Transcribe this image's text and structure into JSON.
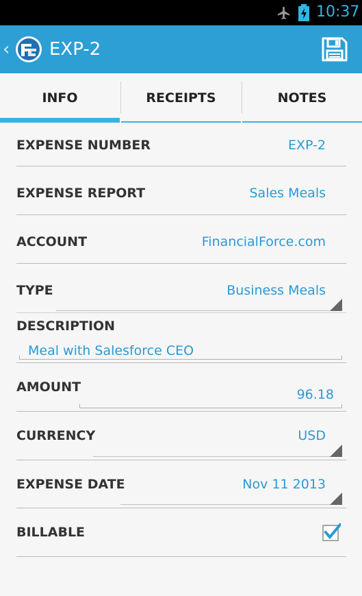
{
  "status_bar": {
    "time": "10:37",
    "accent_color": "#33b5e5"
  },
  "action_bar": {
    "title": "EXP-2",
    "background_color": "#2d9fd5",
    "icons": [
      "back-icon",
      "financialforce-logo",
      "save-icon"
    ]
  },
  "tabs": [
    {
      "label": "INFO",
      "selected": true
    },
    {
      "label": "RECEIPTS",
      "selected": false
    },
    {
      "label": "NOTES",
      "selected": false
    }
  ],
  "fields": {
    "expense_number": {
      "label": "EXPENSE NUMBER",
      "value": "EXP-2"
    },
    "expense_report": {
      "label": "EXPENSE REPORT",
      "value": "Sales Meals"
    },
    "account": {
      "label": "ACCOUNT",
      "value": "FinancialForce.com"
    },
    "type": {
      "label": "TYPE",
      "value": "Business Meals"
    },
    "description": {
      "label": "DESCRIPTION",
      "value": "Meal with Salesforce CEO"
    },
    "amount": {
      "label": "AMOUNT",
      "value": "96.18"
    },
    "currency": {
      "label": "CURRENCY",
      "value": "USD"
    },
    "expense_date": {
      "label": "EXPENSE DATE",
      "value": "Nov 11 2013"
    },
    "billable": {
      "label": "BILLABLE",
      "checked": true
    }
  },
  "colors": {
    "value_text": "#2a9ad4",
    "label_text": "#333333",
    "background": "#f6f6f6"
  }
}
